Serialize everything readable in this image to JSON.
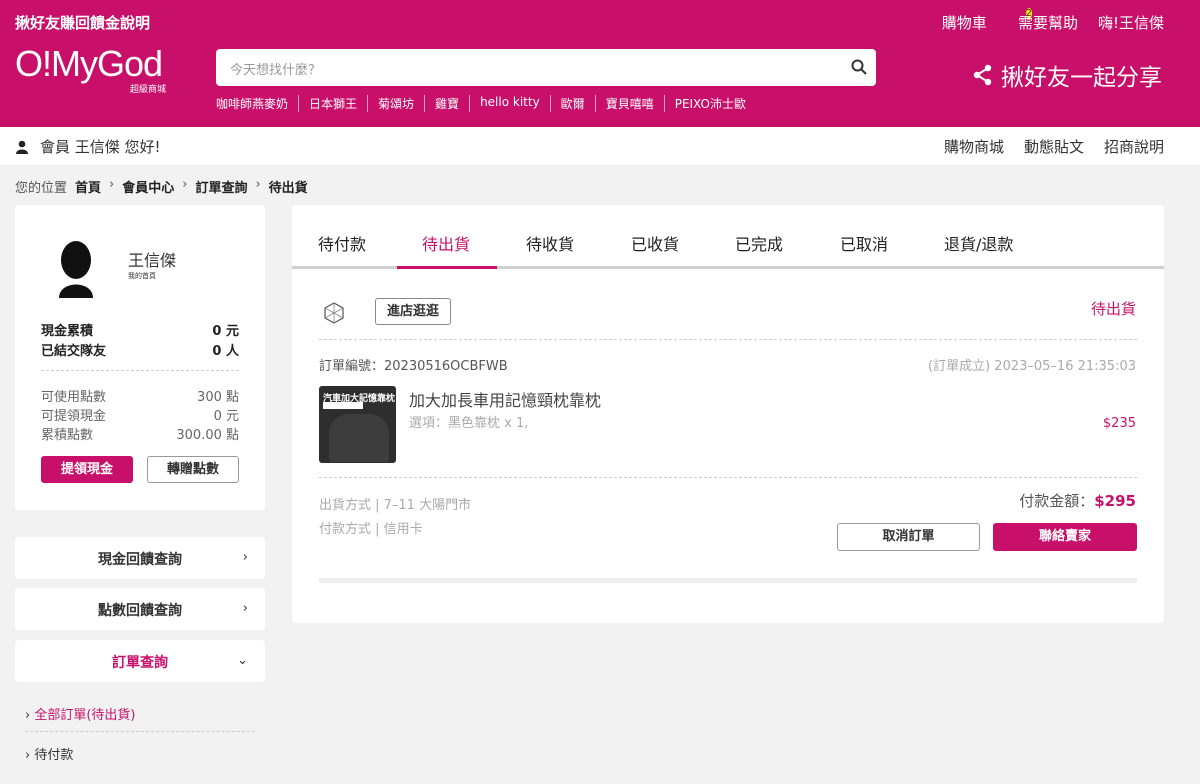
{
  "header": {
    "promo": "揪好友賺回饋金說明",
    "cart_label": "購物車",
    "cart_count": "2",
    "help_label": "需要幫助",
    "greeting": "嗨!王信傑",
    "logo": "O!MyGod",
    "logo_sub": "超級商城",
    "search_placeholder": "今天想找什麼？",
    "hot_tags": [
      "咖啡師燕麥奶",
      "日本獅王",
      "菊頌坊",
      "雞寶",
      "hello kitty",
      "歐爾",
      "寶貝嘻嘻",
      "PEIXO沛士歐"
    ],
    "share_label": "揪好友一起分享"
  },
  "memberbar": {
    "greeting": "會員 王信傑 您好!",
    "nav": [
      "購物商城",
      "動態貼文",
      "招商說明"
    ]
  },
  "breadcrumb": {
    "prefix": "您的位置",
    "items": [
      "首頁",
      "會員中心",
      "訂單查詢",
      "待出貨"
    ]
  },
  "profile": {
    "name": "王信傑",
    "sub": "我的首頁",
    "cash_label": "現金累積",
    "cash_value": "0 元",
    "friends_label": "已結交隊友",
    "friends_value": "0 人",
    "points_label": "可使用點數",
    "points_value": "300 點",
    "withdraw_label": "可提領現金",
    "withdraw_value": "0 元",
    "accum_label": "累積點數",
    "accum_value": "300.00 點",
    "withdraw_btn": "提領現金",
    "transfer_btn": "轉贈點數"
  },
  "menu": {
    "cash_query": "現金回饋查詢",
    "points_query": "點數回饋查詢",
    "order_query": "訂單查詢",
    "sub_all": "全部訂單(待出貨)",
    "sub_pending": "待付款"
  },
  "tabs": [
    "待付款",
    "待出貨",
    "待收貨",
    "已收貨",
    "已完成",
    "已取消",
    "退貨/退款"
  ],
  "order": {
    "visit_btn": "進店逛逛",
    "status": "待出貨",
    "order_no": "訂單編號：20230516OCBFWB",
    "date": "(訂單成立) 2023–05–16 21:35:03",
    "thumb_text": "汽車加大記憶靠枕",
    "product_name": "加大加長車用記憶頸枕靠枕",
    "option": "選項：黑色靠枕 x 1,",
    "price": "$235",
    "shipping": "出貨方式 | 7–11 大陽門市",
    "payment": "付款方式 | 信用卡",
    "total_label": "付款金額：",
    "total_value": "$295",
    "cancel_btn": "取消訂單",
    "contact_btn": "聯絡賣家"
  },
  "colors": {
    "brand": "#c8106a",
    "badge": "#ffe600"
  }
}
